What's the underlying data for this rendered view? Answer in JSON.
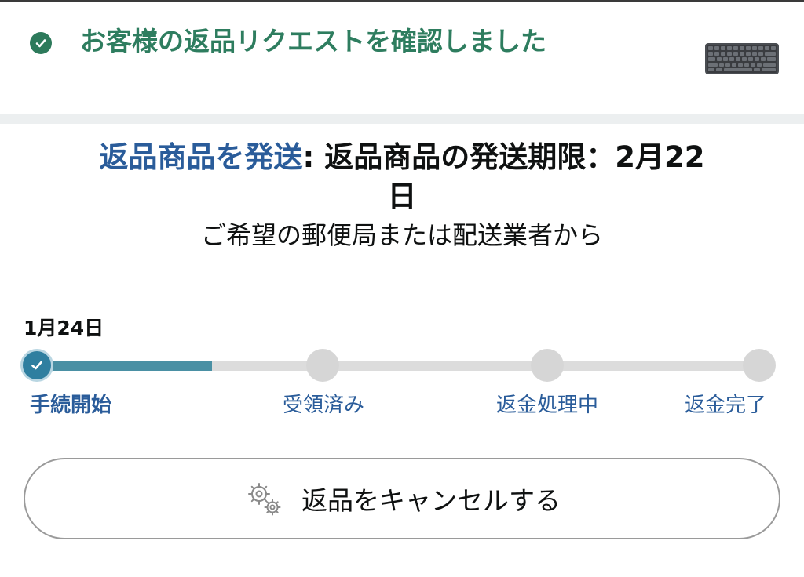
{
  "header": {
    "title": "お客様の返品リクエストを確認しました",
    "status_icon": "check-circle-icon",
    "product_image": "keyboard-thumbnail"
  },
  "shipping": {
    "link_text": "返品商品を発送",
    "separator": ": ",
    "deadline_text": "返品商品の発送期限：2月22日",
    "subtitle": "ご希望の郵便局または配送業者から"
  },
  "progress": {
    "start_date": "1月24日",
    "steps": [
      {
        "label": "手続開始",
        "done": true
      },
      {
        "label": "受領済み",
        "done": false
      },
      {
        "label": "返金処理中",
        "done": false
      },
      {
        "label": "返金完了",
        "done": false
      }
    ]
  },
  "cancel_button": {
    "label": "返品をキャンセルする",
    "icon": "gears-icon"
  },
  "colors": {
    "success_green": "#2e7d5f",
    "link_blue": "#2a5c9a",
    "progress_fill": "#4a90a4",
    "progress_track": "#dcdcdc"
  }
}
